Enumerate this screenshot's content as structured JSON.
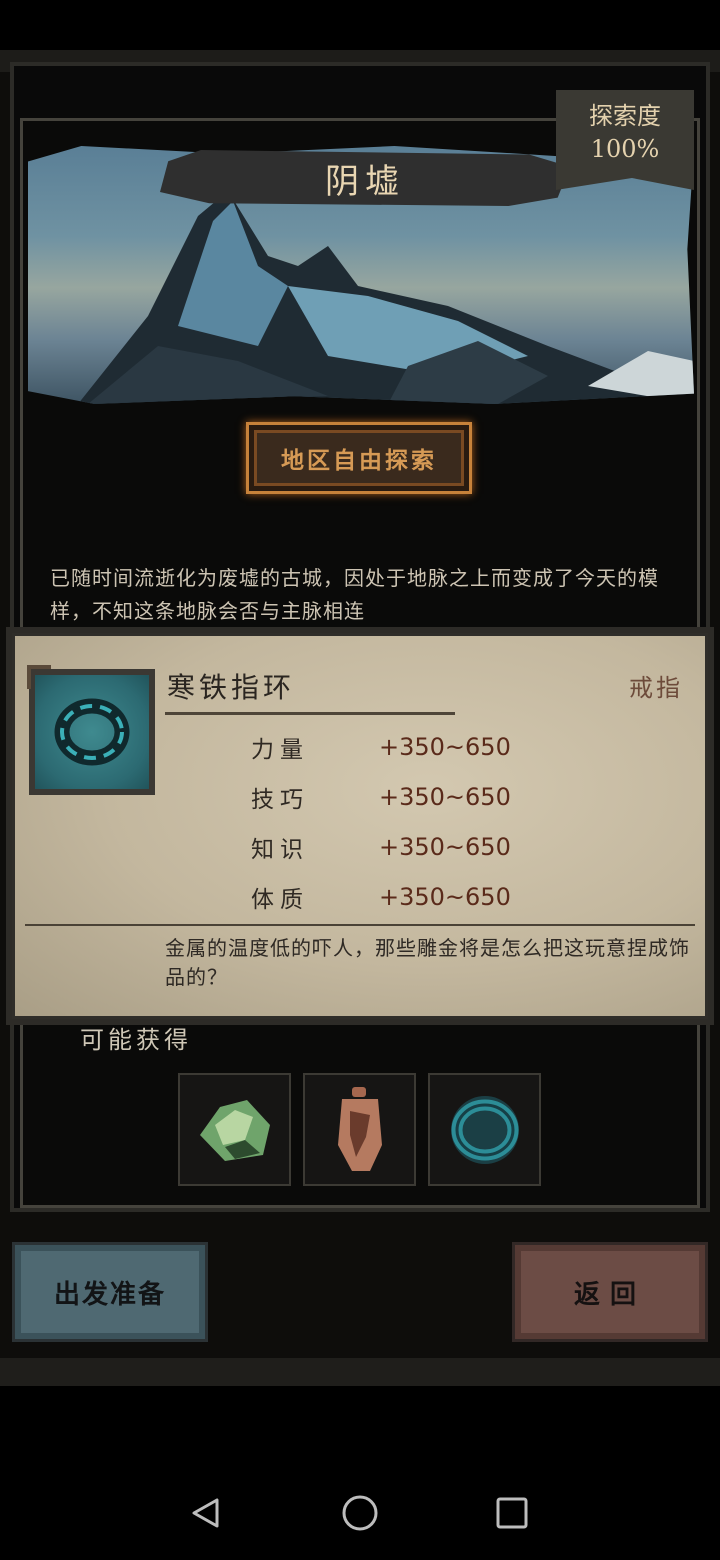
{
  "region": {
    "title": "阴墟",
    "exploration_label": "探索度",
    "exploration_value": "100%",
    "free_explore_label": "地区自由探索",
    "description": "已随时间流逝化为废墟的古城，因处于地脉之上而变成了今天的模样，不知这条地脉会否与主脉相连",
    "drops_label": "可能获得"
  },
  "popup": {
    "item_name": "寒铁指环",
    "item_type": "戒指",
    "stats": [
      {
        "name": "力量",
        "value": "+350~650"
      },
      {
        "name": "技巧",
        "value": "+350~650"
      },
      {
        "name": "知识",
        "value": "+350~650"
      },
      {
        "name": "体质",
        "value": "+350~650"
      }
    ],
    "flavor": "金属的温度低的吓人，那些雕金将是怎么把这玩意捏成饰品的？"
  },
  "buttons": {
    "depart_label": "出发准备",
    "return_label": "返回"
  },
  "drops": [
    "green-ore-icon",
    "bronze-amulet-icon",
    "cold-iron-ring-icon"
  ],
  "colors": {
    "accent_orange": "#c7823a",
    "depart_blue": "#4f6972",
    "return_red": "#6c4c45",
    "parchment": "#c3b79e"
  }
}
